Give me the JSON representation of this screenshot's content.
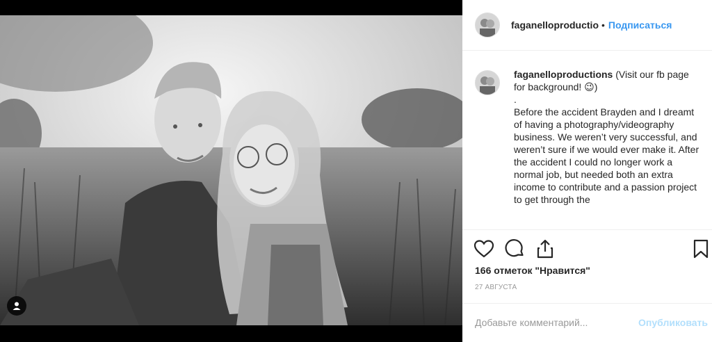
{
  "post": {
    "username_header": "faganelloproductio",
    "follow_label": "Подписаться",
    "dot": "•",
    "caption_username": "faganelloproductions",
    "caption_lines": [
      " (Visit our fb page for background! 😉)",
      ".",
      "Before the accident Brayden and I dreamt of having a photography/videography business. We weren’t very successful, and weren’t sure if we would ever make it. After the accident I could no longer work a normal job, but needed both an extra income to contribute and a passion project to get through the"
    ],
    "likes": "166 отметок \"Нравится\"",
    "date": "27 АВГУСТА",
    "comment_placeholder": "Добавьте комментарий...",
    "publish_label": "Опубликовать"
  },
  "icons": {
    "like": "heart-icon",
    "comment": "comment-bubble-icon",
    "share": "share-icon",
    "save": "bookmark-icon",
    "tag": "user-tag-icon"
  },
  "colors": {
    "accent": "#3897f0",
    "publish_disabled": "#b2dffc",
    "text": "#262626",
    "muted": "#999999"
  }
}
